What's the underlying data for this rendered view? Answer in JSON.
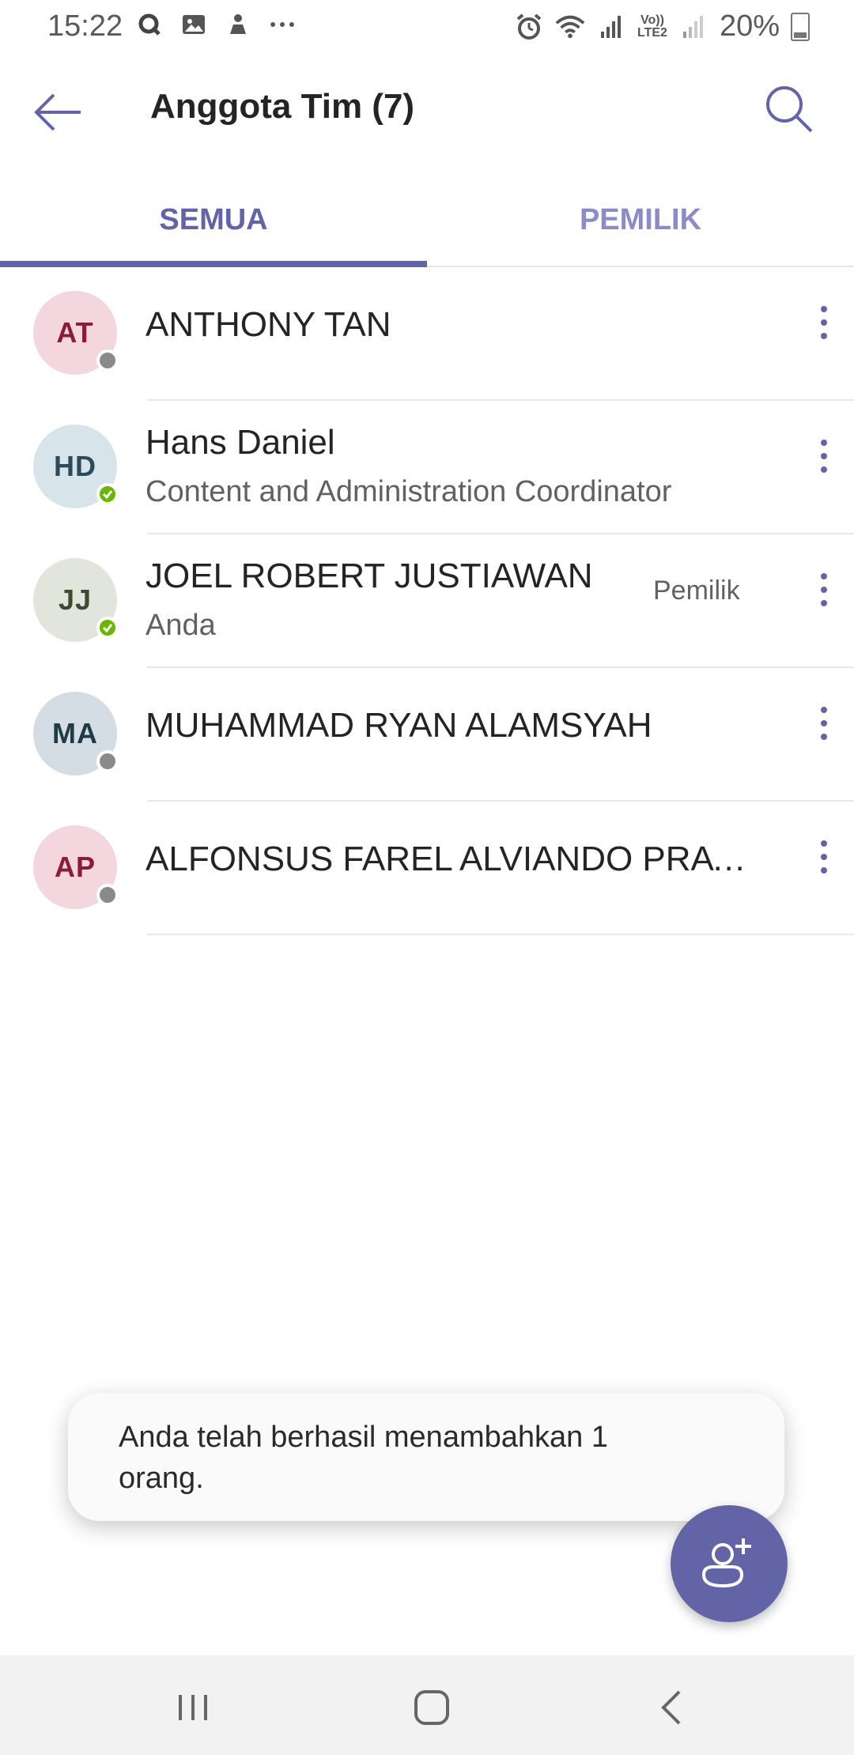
{
  "status_bar": {
    "time": "15:22",
    "left_icons": [
      "q-app-icon",
      "gallery-icon",
      "notification-app-icon",
      "more-notifications-icon"
    ],
    "lte_label_top": "Vo))",
    "lte_label_bottom": "LTE2",
    "battery_percent": "20%",
    "battery_level": 0.2
  },
  "header": {
    "title": "Anggota Tim (7)"
  },
  "tabs": [
    {
      "label": "SEMUA",
      "active": true
    },
    {
      "label": "PEMILIK",
      "active": false
    }
  ],
  "members": [
    {
      "initials": "AT",
      "name": "ANTHONY TAN",
      "subtitle": "",
      "badge": "",
      "presence": "offline",
      "avatar_bg": "#f4d6de",
      "avatar_fg": "#8a1c3b"
    },
    {
      "initials": "HD",
      "name": "Hans Daniel",
      "subtitle": "Content and Administration Coordinator",
      "badge": "",
      "presence": "online",
      "avatar_bg": "#d7e4ea",
      "avatar_fg": "#2b4b5c"
    },
    {
      "initials": "JJ",
      "name": "JOEL ROBERT JUSTIAWAN",
      "subtitle": "Anda",
      "badge": "Pemilik",
      "presence": "online",
      "avatar_bg": "#e2e5dc",
      "avatar_fg": "#3f4a2e"
    },
    {
      "initials": "MA",
      "name": "MUHAMMAD RYAN ALAMSYAH",
      "subtitle": "",
      "badge": "",
      "presence": "offline",
      "avatar_bg": "#d3dde3",
      "avatar_fg": "#213a48"
    },
    {
      "initials": "AP",
      "name": "ALFONSUS FAREL ALVIANDO PRAT...",
      "subtitle": "",
      "badge": "",
      "presence": "offline",
      "avatar_bg": "#f4d6de",
      "avatar_fg": "#8a1c3b"
    }
  ],
  "toast": {
    "line1": "Anda telah berhasil menambahkan 1",
    "line2": "orang."
  },
  "colors": {
    "accent": "#6264a7",
    "accent_light": "#8b8cc7",
    "presence_online": "#6bb700",
    "presence_offline": "#8a8a8a"
  }
}
